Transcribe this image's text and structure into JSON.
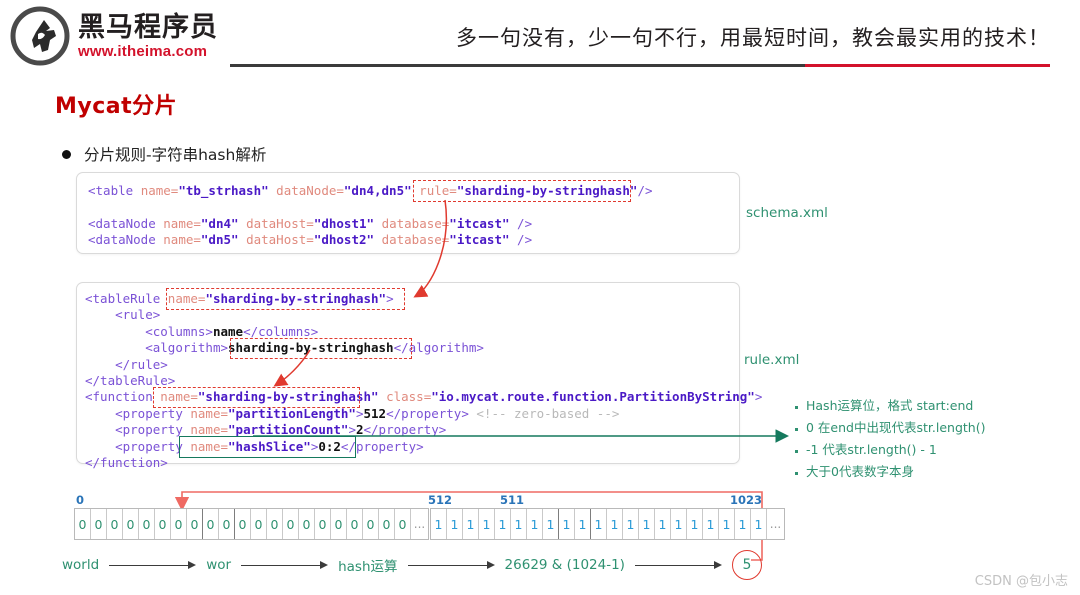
{
  "header": {
    "brand_cn": "黑马程序员",
    "brand_url": "www.itheima.com",
    "slogan": "多一句没有，少一句不行，用最短时间，教会最实用的技术！",
    "logo_alt": "horse-logo"
  },
  "page_title": "Mycat分片",
  "bullet": "分片规则-字符串hash解析",
  "schema_box": {
    "file_label": "schema.xml",
    "lines": [
      "<table name=\"tb_strhash\" dataNode=\"dn4,dn5\" rule=\"sharding-by-stringhash\"/>",
      "",
      "<dataNode name=\"dn4\" dataHost=\"dhost1\" database=\"itcast\" />",
      "<dataNode name=\"dn5\" dataHost=\"dhost2\" database=\"itcast\" />"
    ],
    "highlight": "rule=\"sharding-by-stringhash\""
  },
  "rule_box": {
    "file_label": "rule.xml",
    "lines": [
      "<tableRule name=\"sharding-by-stringhash\">",
      "    <rule>",
      "        <columns>name</columns>",
      "        <algorithm>sharding-by-stringhash</algorithm>",
      "    </rule>",
      "</tableRule>",
      "<function name=\"sharding-by-stringhash\" class=\"io.mycat.route.function.PartitionByString\">",
      "    <property name=\"partitionLength\">512</property> <!-- zero-based -->",
      "    <property name=\"partitionCount\">2</property>",
      "    <property name=\"hashSlice\">0:2</property>",
      "</function>"
    ],
    "highlights": [
      "name=\"sharding-by-stringhash\"",
      "sharding-by-stringhash",
      "name=\"sharding-by-stringhash\"",
      "name=\"hashSlice\">0:2"
    ],
    "values": {
      "partitionLength": "512",
      "partitionCount": "2",
      "hashSlice": "0:2",
      "columns": "name",
      "class": "io.mycat.route.function.PartitionByString",
      "comment": "<!-- zero-based -->"
    }
  },
  "notes": [
    "Hash运算位，格式 start:end",
    "0 在end中出现代表str.length()",
    "-1 代表str.length() - 1",
    "大于0代表数字本身"
  ],
  "bit_array": {
    "left": {
      "start": "0",
      "end": "511",
      "value": "0",
      "count": 21,
      "ellipsis": "..."
    },
    "right": {
      "start": "512",
      "end": "1023",
      "value": "1",
      "count": 21,
      "ellipsis": "..."
    }
  },
  "flow": {
    "nodes": [
      "world",
      "wor",
      "hash运算",
      "26629 & (1024-1)"
    ],
    "result": "5"
  },
  "watermark": "CSDN @包小志",
  "colors": {
    "brand_red": "#d3122b",
    "title_red": "#c00000",
    "green": "#2f9171",
    "highlight_red": "#e03a2f",
    "highlight_green": "#15795d",
    "bit_blue": "#2a9ad6",
    "range_blue": "#2a74b8"
  }
}
